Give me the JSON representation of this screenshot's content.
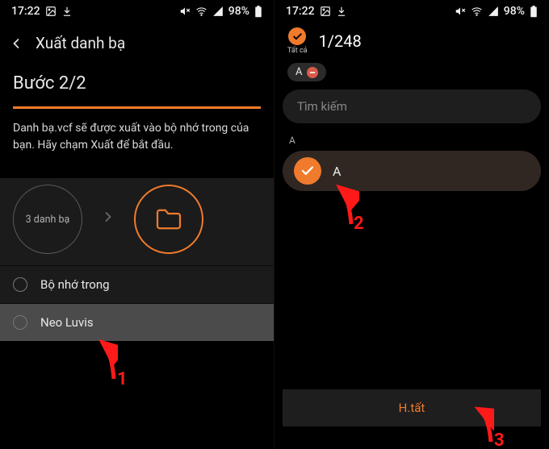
{
  "status": {
    "time": "17:22",
    "battery_pct": "98%"
  },
  "left": {
    "header_title": "Xuất danh bạ",
    "step_title": "Bước 2/2",
    "body_text": "Danh bạ.vcf sẽ được xuất vào bộ nhớ trong của bạn. Hãy chạm Xuất để bắt đầu.",
    "circle_label": "3 danh bạ",
    "options": [
      {
        "label": "Bộ nhớ trong"
      },
      {
        "label": "Neo Luvis"
      }
    ]
  },
  "right": {
    "select_all_label": "Tất cả",
    "count_text": "1/248",
    "chip_label": "A",
    "search_placeholder": "Tìm kiếm",
    "section_label": "A",
    "contact_name": "A",
    "done_label": "H.tất"
  },
  "annotations": {
    "n1": "1",
    "n2": "2",
    "n3": "3"
  }
}
